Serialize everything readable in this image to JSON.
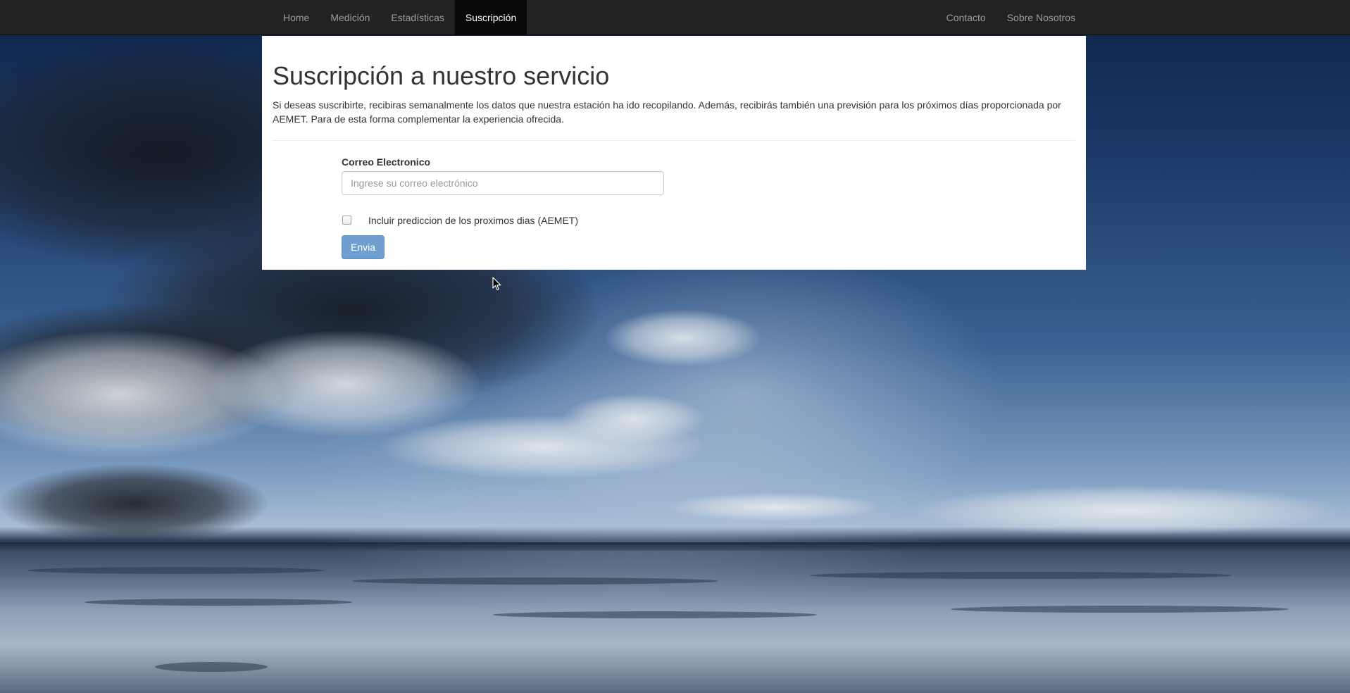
{
  "nav": {
    "left_items": [
      {
        "label": "Home"
      },
      {
        "label": "Medición"
      },
      {
        "label": "Estadísticas"
      },
      {
        "label": "Suscripción",
        "active": true
      }
    ],
    "right_items": [
      {
        "label": "Contacto"
      },
      {
        "label": "Sobre Nosotros"
      }
    ]
  },
  "page": {
    "title": "Suscripción a nuestro servicio",
    "intro": "Si deseas suscribirte, recibiras semanalmente los datos que nuestra estación ha ido recopilando. Además, recibirás también una previsión para los próximos días proporcionada por AEMET. Para de esta forma complementar la experiencia ofrecida."
  },
  "form": {
    "email_label": "Correo Electronico",
    "email_value": "",
    "email_placeholder": "Ingrese su correo electrónico",
    "checkbox_label": "Incluir prediccion de los proximos dias (AEMET)",
    "checkbox_checked": false,
    "submit_label": "Envia"
  },
  "colors": {
    "navbar_bg": "#222222",
    "nav_active_bg": "#080808",
    "nav_text": "#9d9d9d",
    "button_bg": "#6f9fd1"
  },
  "icons": {
    "cursor": "mouse-pointer-icon"
  }
}
